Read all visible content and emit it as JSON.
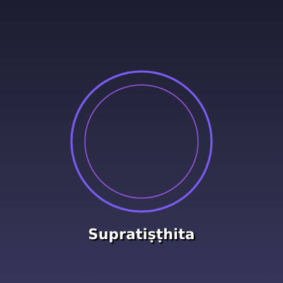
{
  "title": "Supratiṣṭhita",
  "colors": {
    "outer_ring": "#7b5cf0",
    "inner_ring": "#9a55e0",
    "background_top": "#1c1d30",
    "background_bottom": "#36355a",
    "label": "#ffffff"
  }
}
